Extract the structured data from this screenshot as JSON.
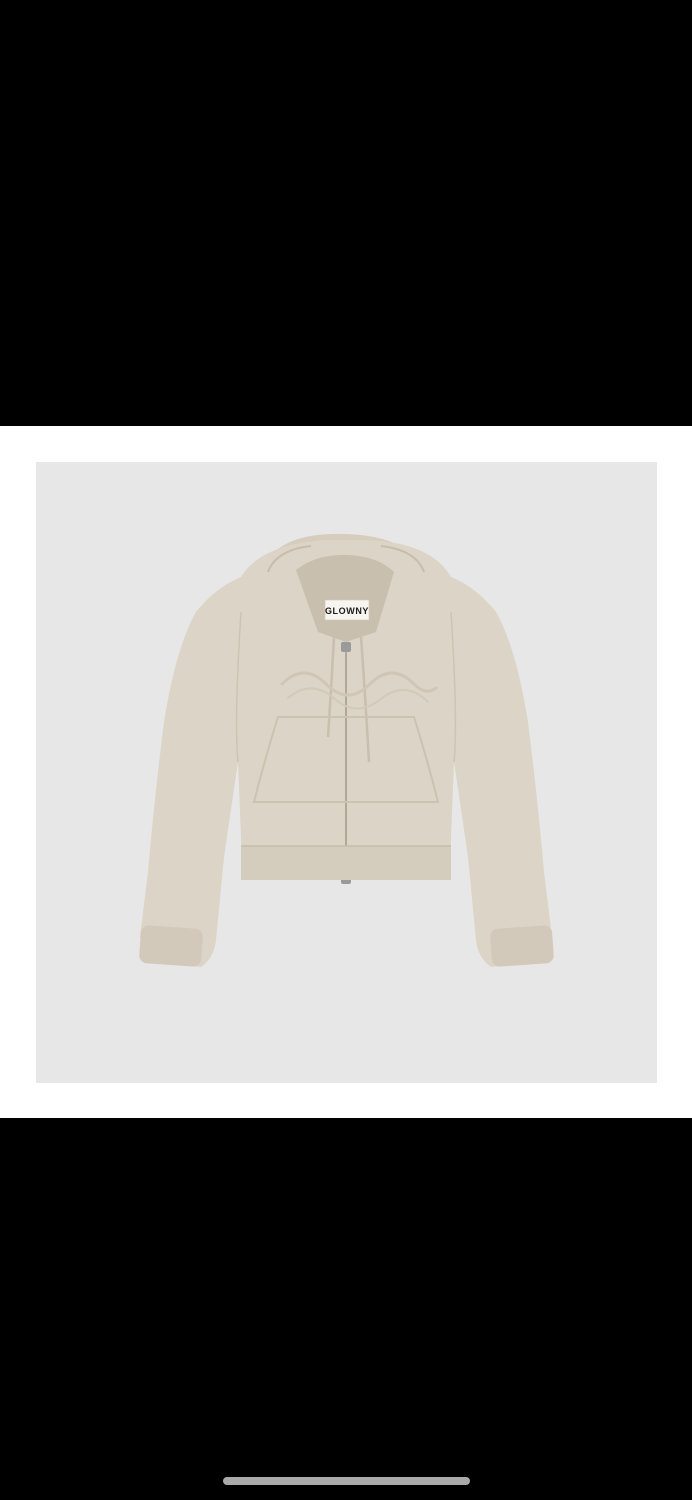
{
  "viewer": {
    "background": "#000000",
    "image": {
      "subject": "cropped-zip-hoodie",
      "brand_label": "GLOWNY",
      "garment_color": "#dcd4c6",
      "backdrop_color": "#e7e7e7"
    },
    "home_indicator": {
      "color": "#a9a9a9"
    }
  }
}
